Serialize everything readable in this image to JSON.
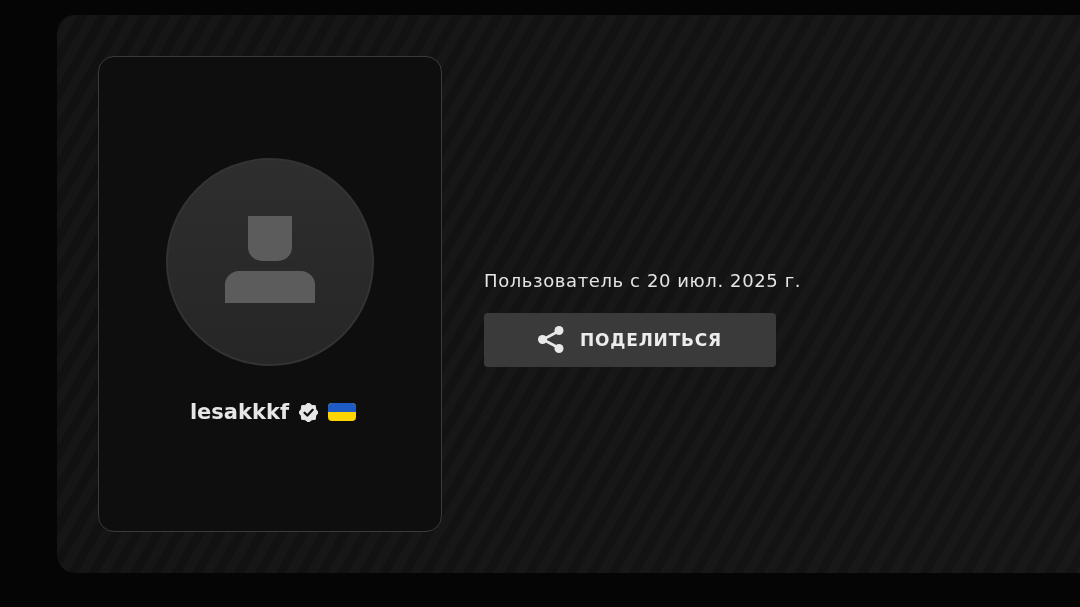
{
  "profile_card": {
    "username": "lesakkkf",
    "verified": true
  },
  "info": {
    "member_since": "Пользователь с 20 июл. 2025 г.",
    "share_button": {
      "label": "ПОДЕЛИТЬСЯ"
    }
  }
}
